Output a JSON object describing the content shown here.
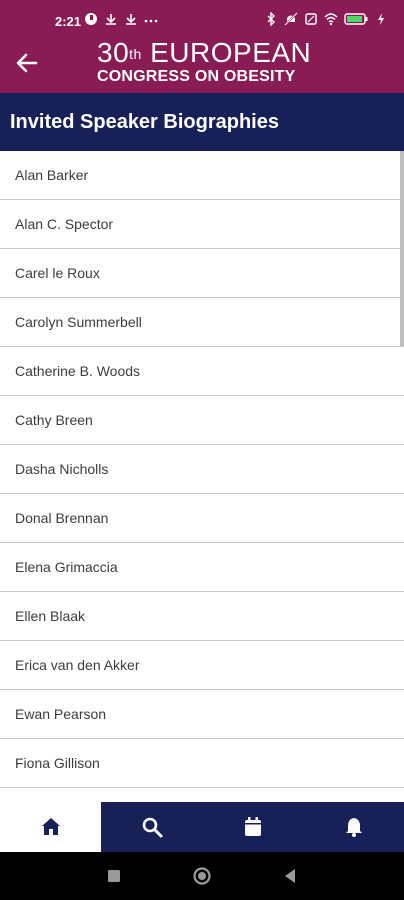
{
  "status_bar": {
    "time": "2:21",
    "left_icons": [
      "notification-icon",
      "download-icon",
      "download-icon",
      "more-dots-icon"
    ],
    "right_icons": [
      "bluetooth-icon",
      "mute-icon",
      "sim-icon",
      "wifi-icon",
      "battery-icon",
      "charging-icon"
    ]
  },
  "header": {
    "brand_number": "30",
    "brand_ordinal": "th",
    "brand_word": "EUROPEAN",
    "brand_line2": "CONGRESS ON OBESITY",
    "back_icon": "arrow-left-icon",
    "background": "#8a1c55"
  },
  "page": {
    "title": "Invited Speaker Biographies",
    "title_bar_color": "#182157"
  },
  "speakers": [
    "Alan Barker",
    "Alan C. Spector",
    "Carel le Roux",
    "Carolyn Summerbell",
    "Catherine B. Woods",
    "Cathy Breen",
    "Dasha Nicholls",
    "Donal Brennan",
    "Elena Grimaccia",
    "Ellen Blaak",
    "Erica van den Akker",
    "Ewan Pearson",
    "Fiona Gillison"
  ],
  "bottom_tabs": [
    {
      "icon": "home-icon",
      "active": true
    },
    {
      "icon": "search-icon",
      "active": false
    },
    {
      "icon": "calendar-icon",
      "active": false
    },
    {
      "icon": "bell-icon",
      "active": false
    }
  ],
  "system_nav": [
    "recent-apps-icon",
    "home-circle-icon",
    "back-triangle-icon"
  ]
}
